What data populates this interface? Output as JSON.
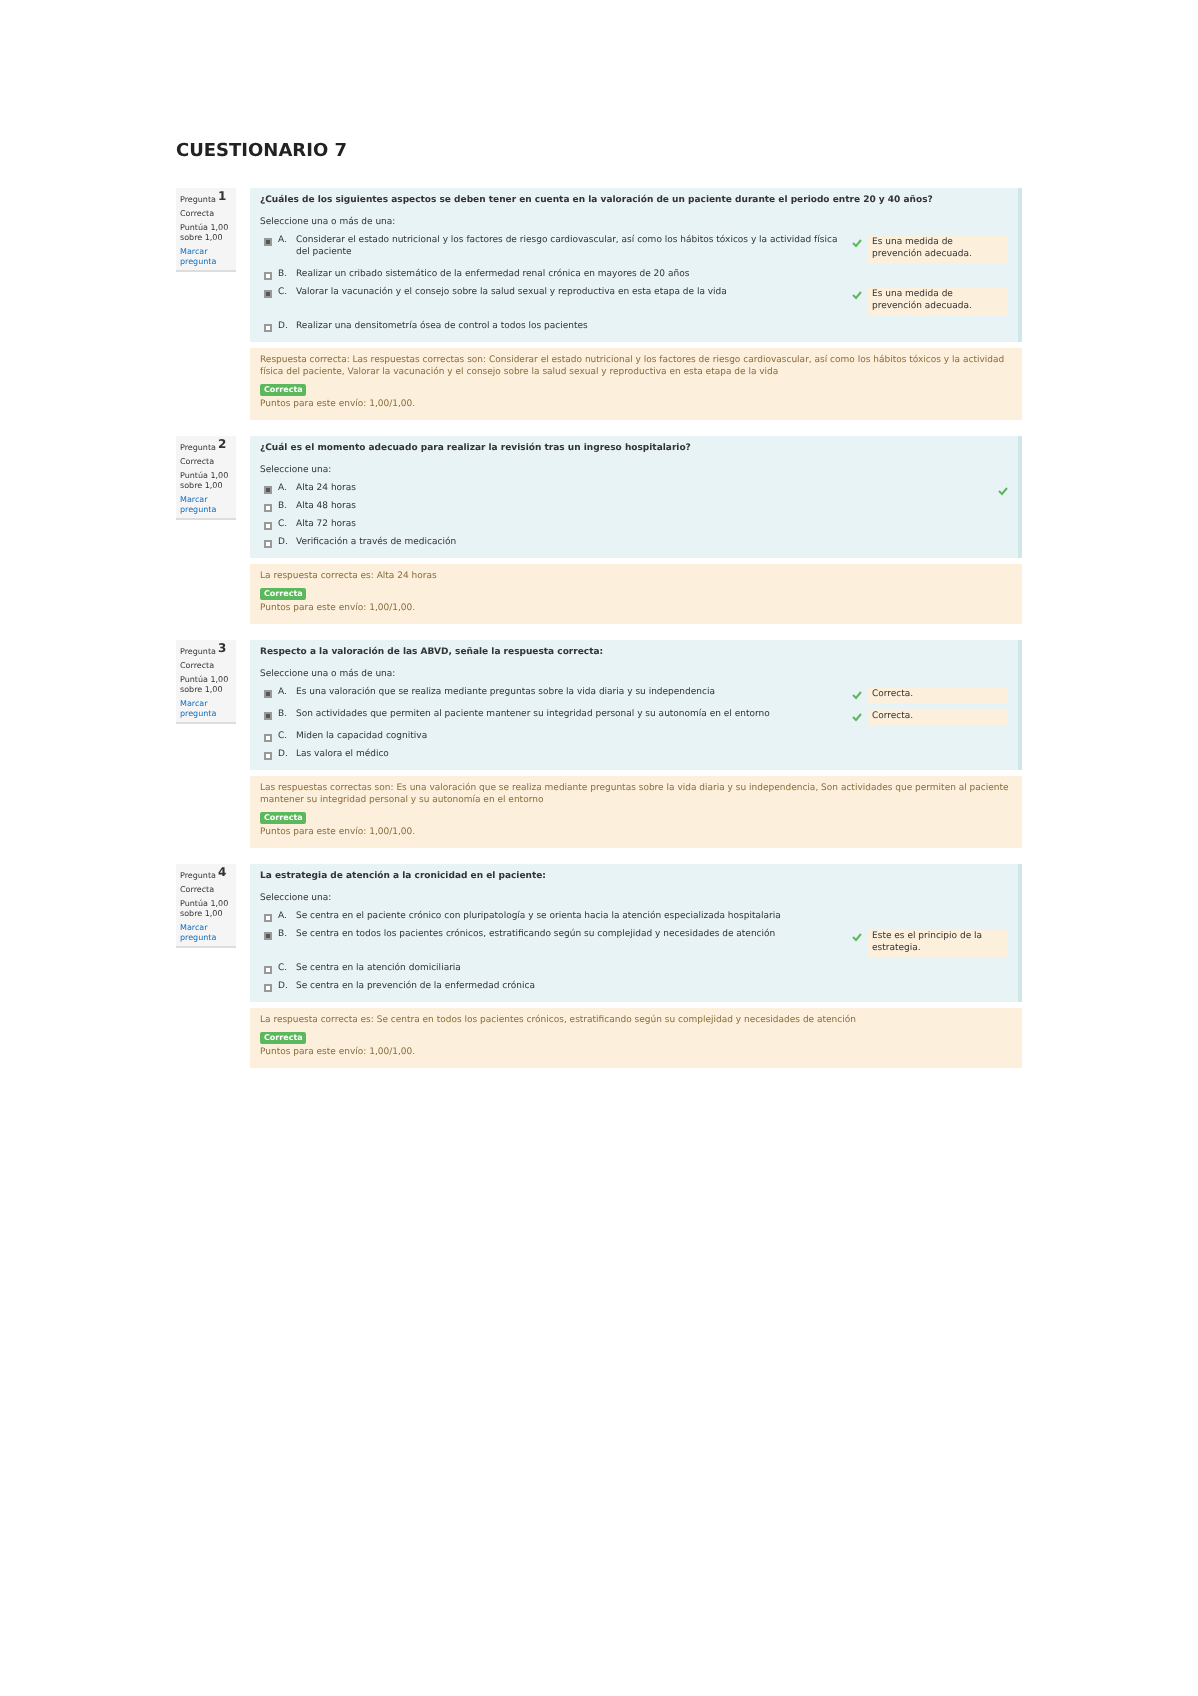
{
  "title": "CUESTIONARIO 7",
  "questions": [
    {
      "label": "Pregunta",
      "number": "1",
      "status": "Correcta",
      "points": "Puntúa 1,00 sobre 1,00",
      "flag": "Marcar pregunta",
      "prompt": "¿Cuáles de los siguientes aspectos se deben tener en cuenta en la valoración de un paciente durante el periodo entre 20 y 40 años?",
      "instruction": "Seleccione una o más de una:",
      "options": [
        {
          "letter": "A.",
          "text": "Considerar el estado nutricional y los factores de riesgo cardiovascular, así como los hábitos tóxicos y la actividad física del paciente",
          "selected": true,
          "feedback": "Es una medida de prevención adecuada."
        },
        {
          "letter": "B.",
          "text": "Realizar un cribado sistemático de la enfermedad renal crónica en mayores de 20 años",
          "selected": false
        },
        {
          "letter": "C.",
          "text": "Valorar la vacunación y el consejo sobre la salud sexual y reproductiva en esta etapa de la vida",
          "selected": true,
          "feedback": "Es una medida de prevención adecuada."
        },
        {
          "letter": "D.",
          "text": "Realizar una densitometría ósea de control a todos los pacientes",
          "selected": false
        }
      ],
      "answer": "Respuesta correcta: Las respuestas correctas son: Considerar el estado nutricional y los factores de riesgo cardiovascular, así como los hábitos tóxicos y la actividad física del paciente, Valorar la vacunación y el consejo sobre la salud sexual y reproductiva en esta etapa de la vida",
      "badge": "Correcta",
      "score": "Puntos para este envío: 1,00/1,00."
    },
    {
      "label": "Pregunta",
      "number": "2",
      "status": "Correcta",
      "points": "Puntúa 1,00 sobre 1,00",
      "flag": "Marcar pregunta",
      "prompt": "¿Cuál es el momento adecuado para realizar la revisión tras un ingreso hospitalario?",
      "instruction": "Seleccione una:",
      "options": [
        {
          "letter": "A.",
          "text": "Alta 24 horas",
          "selected": true
        },
        {
          "letter": "B.",
          "text": "Alta 48 horas",
          "selected": false
        },
        {
          "letter": "C.",
          "text": "Alta 72 horas",
          "selected": false
        },
        {
          "letter": "D.",
          "text": "Verificación a través de medicación",
          "selected": false
        }
      ],
      "answer": "La respuesta correcta es: Alta 24 horas",
      "badge": "Correcta",
      "score": "Puntos para este envío: 1,00/1,00."
    },
    {
      "label": "Pregunta",
      "number": "3",
      "status": "Correcta",
      "points": "Puntúa 1,00 sobre 1,00",
      "flag": "Marcar pregunta",
      "prompt": "Respecto a la valoración de las ABVD, señale la respuesta correcta:",
      "instruction": "Seleccione una o más de una:",
      "options": [
        {
          "letter": "A.",
          "text": "Es una valoración que se realiza mediante preguntas sobre la vida diaria y su independencia",
          "selected": true,
          "feedback": "Correcta."
        },
        {
          "letter": "B.",
          "text": "Son actividades que permiten al paciente mantener su integridad personal y su autonomía en el entorno",
          "selected": true,
          "feedback": "Correcta."
        },
        {
          "letter": "C.",
          "text": "Miden la capacidad cognitiva",
          "selected": false
        },
        {
          "letter": "D.",
          "text": "Las valora el médico",
          "selected": false
        }
      ],
      "answer": "Las respuestas correctas son: Es una valoración que se realiza mediante preguntas sobre la vida diaria y su independencia, Son actividades que permiten al paciente mantener su integridad personal y su autonomía en el entorno",
      "badge": "Correcta",
      "score": "Puntos para este envío: 1,00/1,00."
    },
    {
      "label": "Pregunta",
      "number": "4",
      "status": "Correcta",
      "points": "Puntúa 1,00 sobre 1,00",
      "flag": "Marcar pregunta",
      "prompt": "La estrategia de atención a la cronicidad en el paciente:",
      "instruction": "Seleccione una:",
      "options": [
        {
          "letter": "A.",
          "text": "Se centra en el paciente crónico con pluripatología y se orienta hacia la atención especializada hospitalaria",
          "selected": false
        },
        {
          "letter": "B.",
          "text": "Se centra en todos los pacientes crónicos, estratificando según su complejidad y necesidades de atención",
          "selected": true,
          "feedback": "Este es el principio de la estrategia."
        },
        {
          "letter": "C.",
          "text": "Se centra en la atención domiciliaria",
          "selected": false
        },
        {
          "letter": "D.",
          "text": "Se centra en la prevención de la enfermedad crónica",
          "selected": false
        }
      ],
      "answer": "La respuesta correcta es: Se centra en todos los pacientes crónicos, estratificando según su complejidad y necesidades de atención",
      "badge": "Correcta",
      "score": "Puntos para este envío: 1,00/1,00."
    }
  ]
}
